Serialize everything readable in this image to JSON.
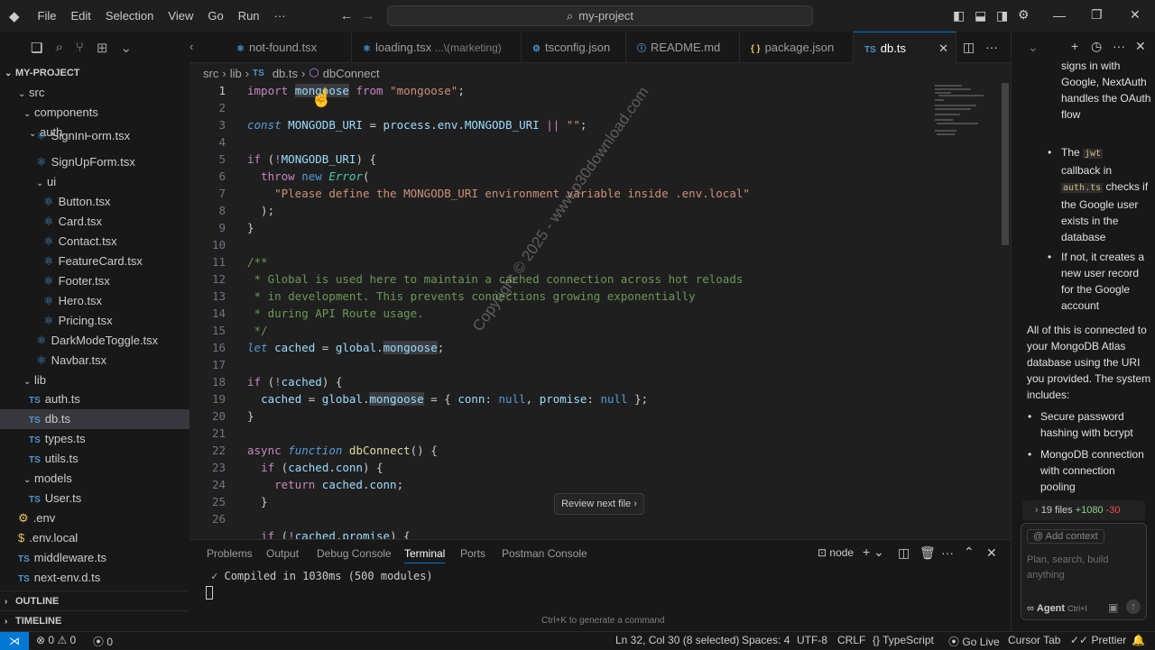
{
  "menu": [
    "File",
    "Edit",
    "Selection",
    "View",
    "Go",
    "Run",
    "···"
  ],
  "search_title": "my-project",
  "explorer": {
    "title": "MY-PROJECT",
    "items": [
      {
        "label": "src",
        "type": "folder"
      },
      {
        "label": "components",
        "type": "folder"
      },
      {
        "label": "auth",
        "type": "folder"
      },
      {
        "label": "SignInForm.tsx",
        "type": "file"
      },
      {
        "label": "SignUpForm.tsx",
        "type": "file"
      },
      {
        "label": "ui",
        "type": "folder"
      },
      {
        "label": "Button.tsx",
        "type": "file"
      },
      {
        "label": "Card.tsx",
        "type": "file"
      },
      {
        "label": "Contact.tsx",
        "type": "file"
      },
      {
        "label": "FeatureCard.tsx",
        "type": "file"
      },
      {
        "label": "Footer.tsx",
        "type": "file"
      },
      {
        "label": "Hero.tsx",
        "type": "file"
      },
      {
        "label": "Pricing.tsx",
        "type": "file"
      },
      {
        "label": "DarkModeToggle.tsx",
        "type": "file"
      },
      {
        "label": "Navbar.tsx",
        "type": "file"
      },
      {
        "label": "lib",
        "type": "folder"
      },
      {
        "label": "auth.ts",
        "type": "ts"
      },
      {
        "label": "db.ts",
        "type": "ts"
      },
      {
        "label": "types.ts",
        "type": "ts"
      },
      {
        "label": "utils.ts",
        "type": "ts"
      },
      {
        "label": "models",
        "type": "folder"
      },
      {
        "label": "User.ts",
        "type": "ts"
      },
      {
        "label": ".env",
        "type": "env"
      },
      {
        "label": ".env.local",
        "type": "env"
      },
      {
        "label": "middleware.ts",
        "type": "ts"
      },
      {
        "label": "next-env.d.ts",
        "type": "ts"
      }
    ],
    "outline": "OUTLINE",
    "timeline": "TIMELINE",
    "ts_badge": "TS"
  },
  "tabs": [
    {
      "label": "not-found.tsx",
      "desc": ""
    },
    {
      "label": "loading.tsx",
      "desc": "...\\(marketing)"
    },
    {
      "label": "tsconfig.json",
      "desc": ""
    },
    {
      "label": "README.md",
      "desc": ""
    },
    {
      "label": "package.json",
      "desc": ""
    },
    {
      "label": "db.ts",
      "desc": ""
    }
  ],
  "breadcrumb": [
    "src",
    "lib",
    "db.ts",
    "dbConnect"
  ],
  "line_numbers": [
    "1",
    "2",
    "3",
    "4",
    "5",
    "6",
    "7",
    "8",
    "9",
    "10",
    "11",
    "12",
    "13",
    "14",
    "15",
    "16",
    "17",
    "18",
    "19",
    "20",
    "21",
    "22",
    "23",
    "24",
    "25",
    "26"
  ],
  "watermark": "Copyright © 2025 - www.p30download.com",
  "review_button": "Review next file",
  "panel": {
    "tabs": [
      "Problems",
      "Output",
      "Debug Console",
      "Terminal",
      "Ports",
      "Postman Console"
    ],
    "shell": "node",
    "output": "Compiled in 1030ms (500 modules)",
    "hint": "Ctrl+K to generate a command"
  },
  "chat": {
    "p1": "signs in with Google, NextAuth handles the OAuth flow",
    "b2a": "The ",
    "b2code": "jwt",
    "b2b": " callback in ",
    "b2code2": "auth.ts",
    "b2c": " checks if the Google user exists in the database",
    "b3": "If not, it creates a new user record for the Google account",
    "p2": "All of this is connected to your MongoDB Atlas database using the URI you provided. The system includes:",
    "b4": "Secure password hashing with bcrypt",
    "b5": "MongoDB connection with connection pooling",
    "files": "19 files",
    "added": "+1080",
    "removed": "-30",
    "add_context": "Add context",
    "input_placeholder": "Plan, search, build anything",
    "agent": "Agent",
    "agent_shortcut": "Ctrl+I"
  },
  "status": {
    "errors": "0",
    "warnings": "0",
    "ports": "0",
    "position": "Ln 32, Col 30 (8 selected)",
    "spaces": "Spaces: 4",
    "encoding": "UTF-8",
    "eol": "CRLF",
    "language": "TypeScript",
    "golive": "Go Live",
    "cursortab": "Cursor Tab",
    "prettier": "Prettier"
  },
  "colors": {
    "accent": "#0078d4",
    "ts": "#4e94ce",
    "env": "#e8c465"
  }
}
